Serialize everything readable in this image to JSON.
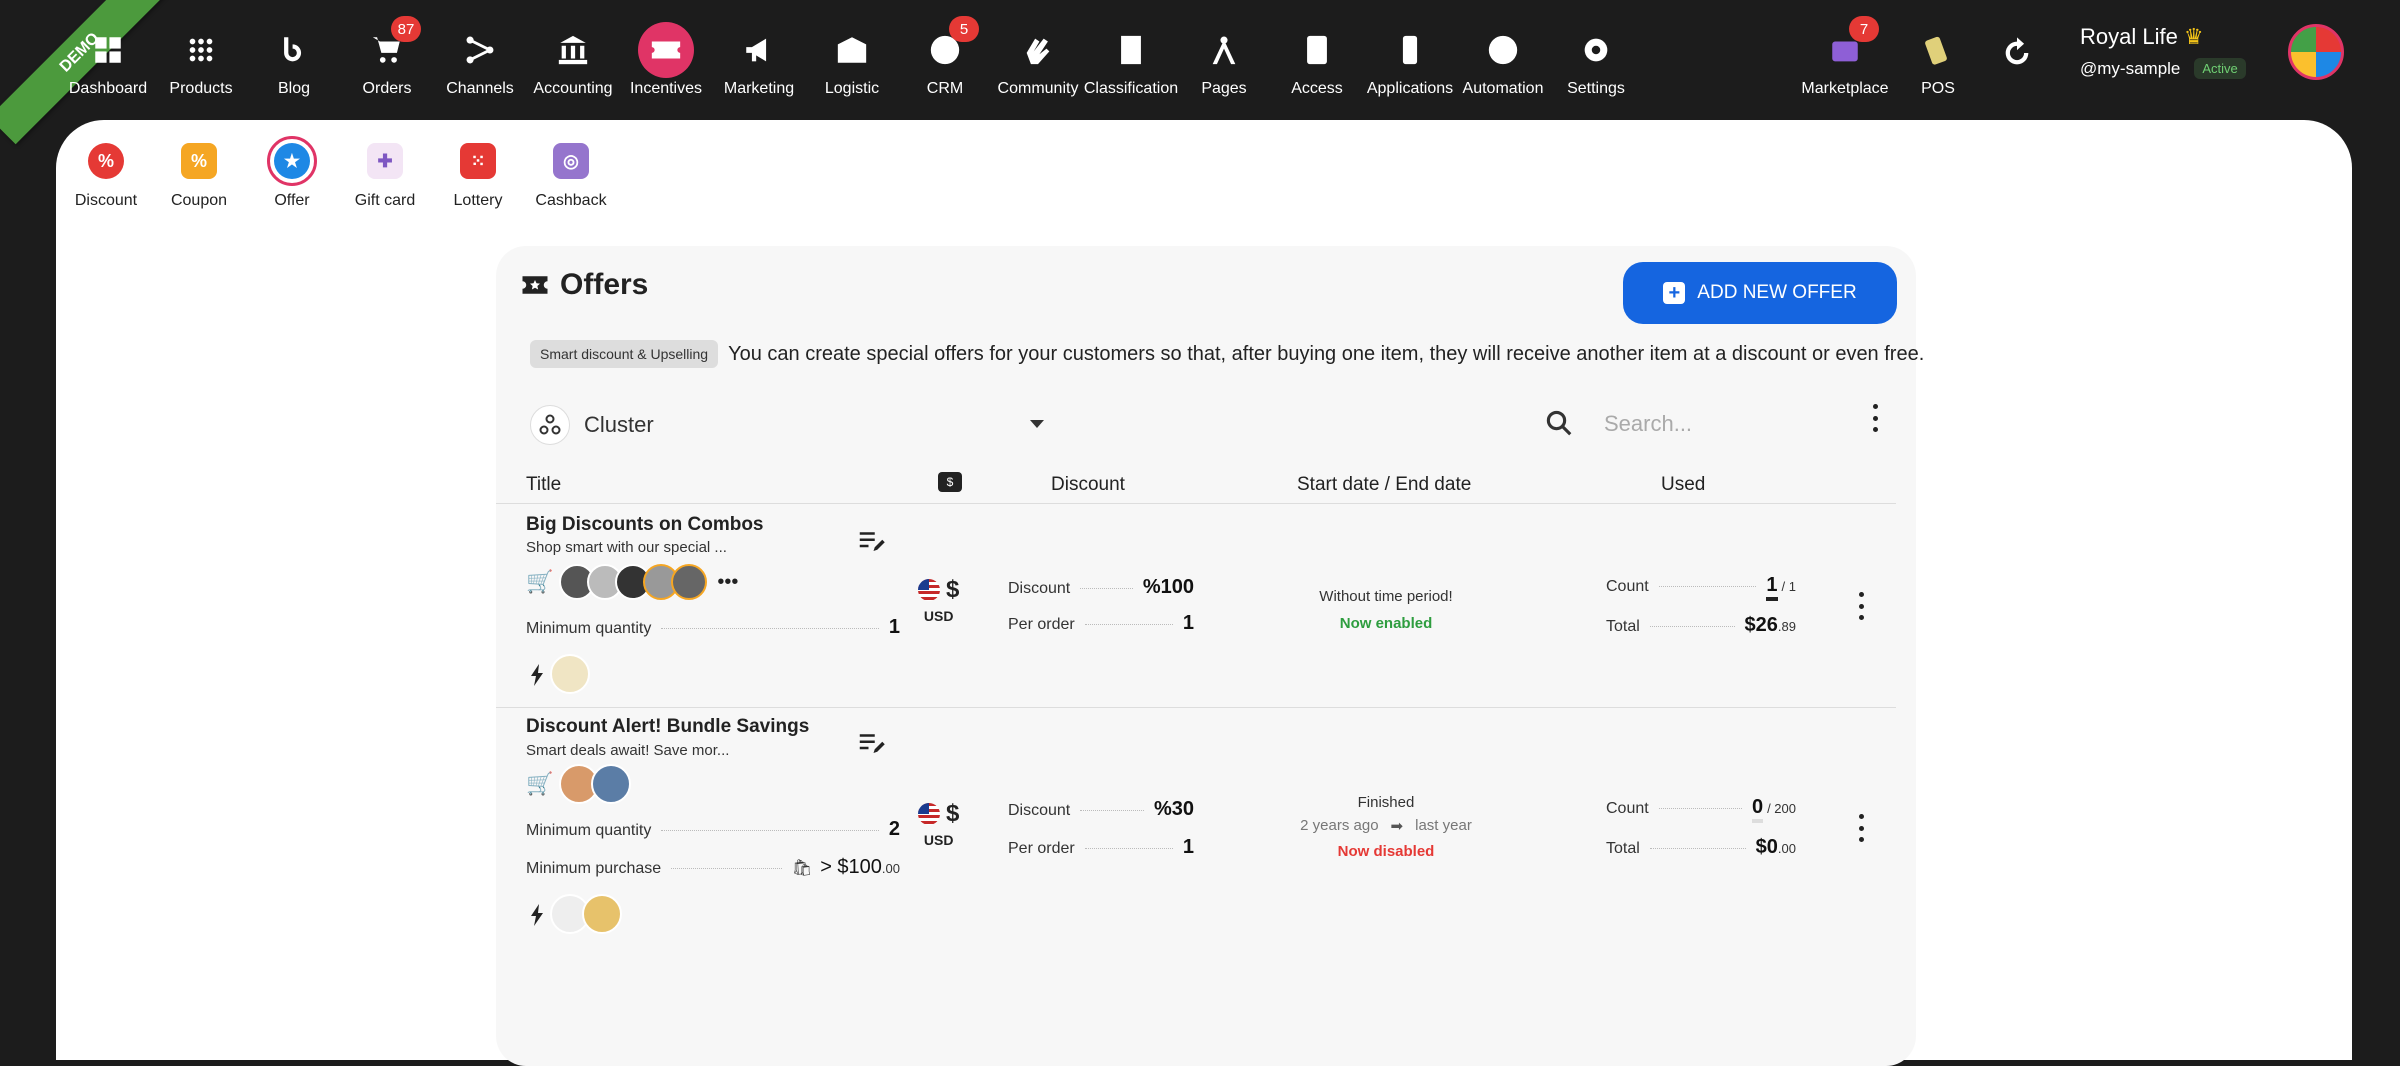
{
  "topbar": {
    "demo_label": "DEMO",
    "nav": [
      {
        "label": "Dashboard",
        "icon": "dashboard-icon"
      },
      {
        "label": "Products",
        "icon": "grid-icon"
      },
      {
        "label": "Blog",
        "icon": "blog-icon"
      },
      {
        "label": "Orders",
        "icon": "cart-icon",
        "badge": "87"
      },
      {
        "label": "Channels",
        "icon": "channels-icon"
      },
      {
        "label": "Accounting",
        "icon": "accounting-icon"
      },
      {
        "label": "Incentives",
        "icon": "ticket-icon",
        "active": true
      },
      {
        "label": "Marketing",
        "icon": "megaphone-icon"
      },
      {
        "label": "Logistic",
        "icon": "warehouse-icon"
      },
      {
        "label": "CRM",
        "icon": "crm-icon",
        "badge": "5"
      },
      {
        "label": "Community",
        "icon": "community-icon"
      },
      {
        "label": "Classification",
        "icon": "book-icon"
      },
      {
        "label": "Pages",
        "icon": "compass-icon"
      },
      {
        "label": "Access",
        "icon": "badge-icon"
      },
      {
        "label": "Applications",
        "icon": "phone-icon"
      },
      {
        "label": "Automation",
        "icon": "bolt-icon"
      },
      {
        "label": "Settings",
        "icon": "gear-icon"
      }
    ],
    "marketplace": {
      "label": "Marketplace",
      "badge": "7"
    },
    "pos": {
      "label": "POS"
    },
    "user": {
      "name": "Royal Life",
      "handle": "@my-sample",
      "status": "Active"
    }
  },
  "subnav": [
    {
      "label": "Discount",
      "color": "#e53935"
    },
    {
      "label": "Coupon",
      "color": "#f5a623"
    },
    {
      "label": "Offer",
      "color": "#1e88e5",
      "active": true
    },
    {
      "label": "Gift card",
      "color": "#7e57c2"
    },
    {
      "label": "Lottery",
      "color": "#e53935"
    },
    {
      "label": "Cashback",
      "color": "#9575cd"
    }
  ],
  "offers": {
    "title": "Offers",
    "add_button": "ADD NEW OFFER",
    "chip": "Smart discount & Upselling",
    "intro": "You can create special offers for your customers so that, after buying one item, they will receive another item at a discount or even free.",
    "cluster": "Cluster",
    "search_placeholder": "Search...",
    "headers": {
      "title": "Title",
      "discount": "Discount",
      "dates": "Start date / End date",
      "used": "Used"
    },
    "rows": [
      {
        "title": "Big Discounts on Combos",
        "subtitle": "Shop smart with our special ...",
        "min_qty_label": "Minimum quantity",
        "min_qty": "1",
        "currency_symbol": "$",
        "currency_code": "USD",
        "discount_label": "Discount",
        "discount": "%100",
        "per_order_label": "Per order",
        "per_order": "1",
        "period_line": "Without time period!",
        "status": "Now enabled",
        "count_label": "Count",
        "count": "1",
        "count_total": "/ 1",
        "total_label": "Total",
        "total_main": "$26",
        "total_cents": ".89"
      },
      {
        "title": "Discount Alert! Bundle Savings",
        "subtitle": "Smart deals await! Save mor...",
        "min_qty_label": "Minimum quantity",
        "min_qty": "2",
        "min_purchase_label": "Minimum purchase",
        "min_purchase_main": "> $100",
        "min_purchase_cents": ".00",
        "currency_symbol": "$",
        "currency_code": "USD",
        "discount_label": "Discount",
        "discount": "%30",
        "per_order_label": "Per order",
        "per_order": "1",
        "period_line": "Finished",
        "from": "2 years ago",
        "to": "last year",
        "status": "Now disabled",
        "count_label": "Count",
        "count": "0",
        "count_total": "/ 200",
        "total_label": "Total",
        "total_main": "$0",
        "total_cents": ".00"
      }
    ]
  }
}
